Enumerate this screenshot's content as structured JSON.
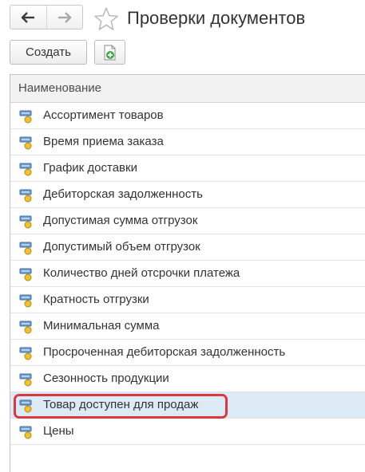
{
  "header": {
    "title": "Проверки документов",
    "back_icon": "arrow-left-icon",
    "forward_icon": "arrow-right-icon",
    "favorite_icon": "star-icon"
  },
  "toolbar": {
    "create_label": "Создать",
    "add_icon": "add-document-icon"
  },
  "table": {
    "column_header": "Наименование",
    "rows": [
      {
        "label": "Ассортимент товаров"
      },
      {
        "label": "Время приема заказа"
      },
      {
        "label": "График доставки"
      },
      {
        "label": "Дебиторская задолженность"
      },
      {
        "label": "Допустимая сумма отгрузок"
      },
      {
        "label": "Допустимый объем отгрузок"
      },
      {
        "label": "Количество дней отсрочки платежа"
      },
      {
        "label": "Кратность отгрузки"
      },
      {
        "label": "Минимальная сумма"
      },
      {
        "label": "Просроченная дебиторская задолженность"
      },
      {
        "label": "Сезонность продукции"
      },
      {
        "label": "Товар доступен для продаж",
        "selected": true
      },
      {
        "label": "Цены"
      }
    ]
  },
  "colors": {
    "selection": "#dceaf6",
    "highlight_border": "#d9393f",
    "add_icon_green": "#3aa845"
  }
}
